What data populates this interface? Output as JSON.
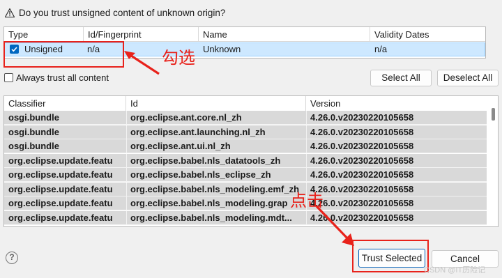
{
  "dialog": {
    "question": "Do you trust unsigned content of unknown origin?",
    "warning_icon": "warning-triangle-icon"
  },
  "top_table": {
    "columns": [
      "Type",
      "Id/Fingerprint",
      "Name",
      "Validity Dates"
    ],
    "rows": [
      {
        "checked": true,
        "type": "Unsigned",
        "id": "n/a",
        "name": "Unknown",
        "validity": "n/a"
      }
    ]
  },
  "always_trust": {
    "label": "Always trust all content",
    "checked": false
  },
  "buttons": {
    "select_all": "Select All",
    "deselect_all": "Deselect All",
    "trust_selected": "Trust Selected",
    "cancel": "Cancel"
  },
  "bottom_table": {
    "columns": [
      "Classifier",
      "Id",
      "Version"
    ],
    "rows": [
      {
        "classifier": "osgi.bundle",
        "id": "org.eclipse.ant.core.nl_zh",
        "version": "4.26.0.v20230220105658"
      },
      {
        "classifier": "osgi.bundle",
        "id": "org.eclipse.ant.launching.nl_zh",
        "version": "4.26.0.v20230220105658"
      },
      {
        "classifier": "osgi.bundle",
        "id": "org.eclipse.ant.ui.nl_zh",
        "version": "4.26.0.v20230220105658"
      },
      {
        "classifier": "org.eclipse.update.featu",
        "id": "org.eclipse.babel.nls_datatools_zh",
        "version": "4.26.0.v20230220105658"
      },
      {
        "classifier": "org.eclipse.update.featu",
        "id": "org.eclipse.babel.nls_eclipse_zh",
        "version": "4.26.0.v20230220105658"
      },
      {
        "classifier": "org.eclipse.update.featu",
        "id": "org.eclipse.babel.nls_modeling.emf_zh",
        "version": "4.26.0.v20230220105658"
      },
      {
        "classifier": "org.eclipse.update.featu",
        "id": "org.eclipse.babel.nls_modeling.grap",
        "version": "4.26.0.v20230220105658"
      },
      {
        "classifier": "org.eclipse.update.featu",
        "id": "org.eclipse.babel.nls_modeling.mdt...",
        "version": "4.26.0.v20230220105658"
      }
    ]
  },
  "annotations": {
    "check_label": "勾选",
    "click_label": "点击",
    "color": "#e8221b"
  },
  "help_icon": "help-icon",
  "watermark": "CSDN @IT历险记"
}
